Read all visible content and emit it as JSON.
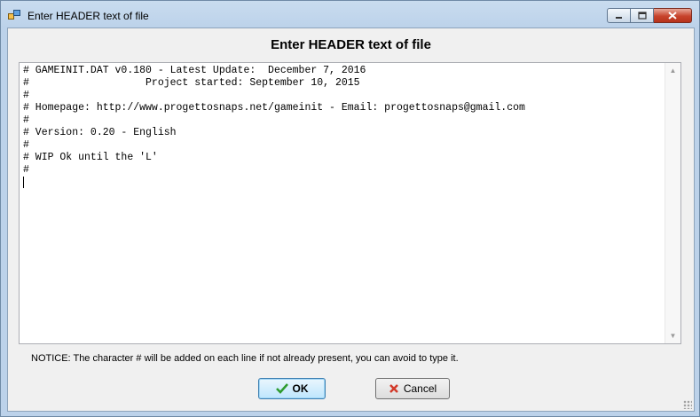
{
  "window": {
    "title": "Enter HEADER text of file",
    "icon": "app-window-icon",
    "controls": [
      "minimize-icon",
      "maximize-icon",
      "close-icon"
    ]
  },
  "dialog": {
    "heading": "Enter HEADER text of file",
    "editor": {
      "lines": [
        "# GAMEINIT.DAT v0.180 - Latest Update:  December 7, 2016",
        "#                   Project started: September 10, 2015",
        "#",
        "# Homepage: http://www.progettosnaps.net/gameinit - Email: progettosnaps@gmail.com",
        "#",
        "# Version: 0.20 - English",
        "#",
        "# WIP Ok until the 'L'",
        "#"
      ]
    },
    "notice": "NOTICE: The character # will be added on each line if not already present, you can avoid to type it.",
    "ok_label": "OK",
    "cancel_label": "Cancel"
  },
  "colors": {
    "titlebar": "#bcd2ea",
    "close_button": "#c7432c",
    "ok_border": "#3c7fb1",
    "ok_check": "#2e9b2e",
    "cancel_x": "#d23a2a"
  }
}
